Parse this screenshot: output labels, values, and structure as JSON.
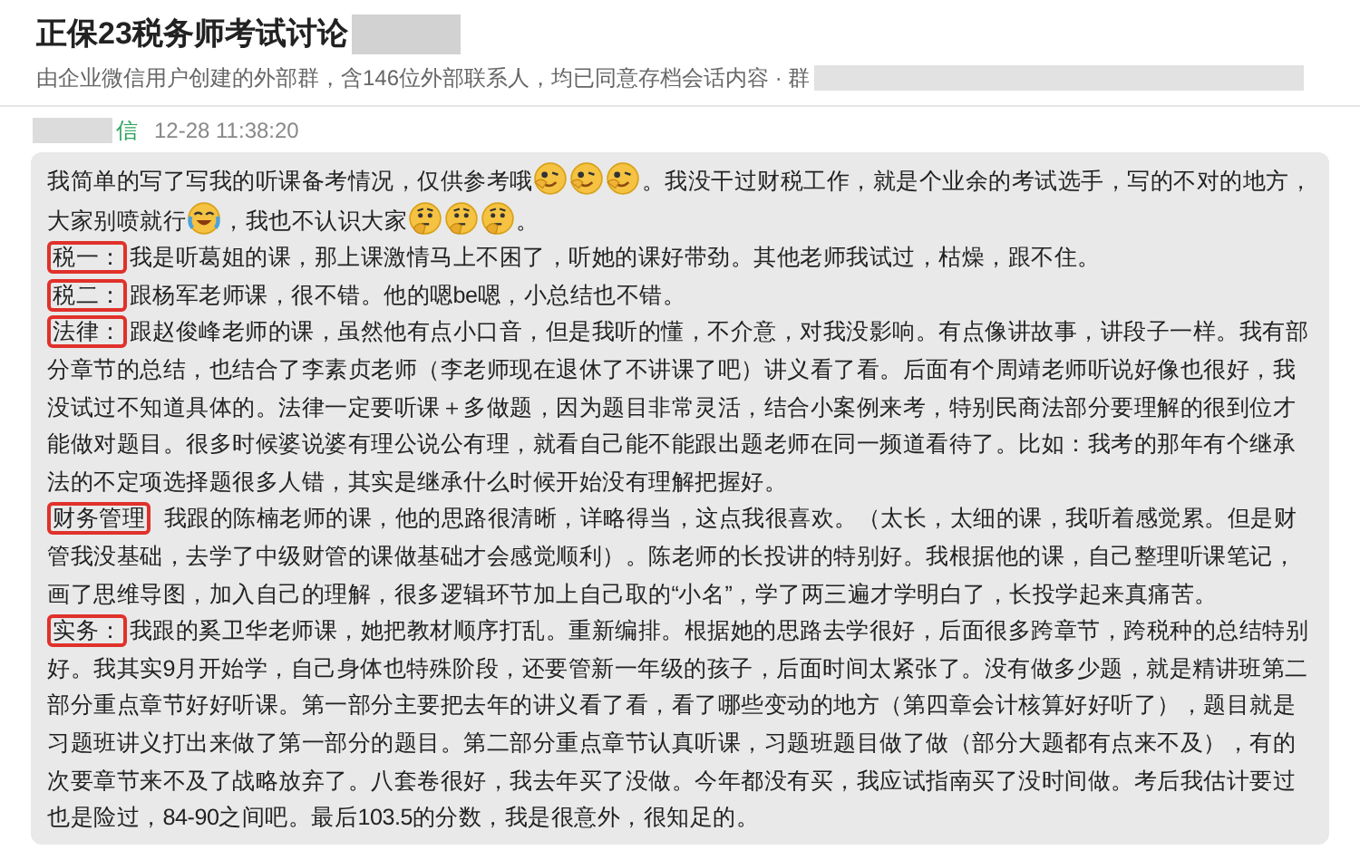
{
  "header": {
    "title": "正保23税务师考试讨论",
    "subtitle": "由企业微信用户创建的外部群，含146位外部联系人，均已同意存档会话内容 · 群"
  },
  "message": {
    "sender": "信",
    "time": "12-28 11:38:20",
    "intro": [
      {
        "kind": "text",
        "text": "我简单的写了写我的听课备考情况，仅供参考哦"
      },
      {
        "kind": "smirk"
      },
      {
        "kind": "smirk"
      },
      {
        "kind": "smirk"
      },
      {
        "kind": "text",
        "text": "。我没干过财税工作，就是个业余的考试选手，写的不对的地方，大家别喷就行"
      },
      {
        "kind": "laugh"
      },
      {
        "kind": "text",
        "text": "，我也不认识大家"
      },
      {
        "kind": "think"
      },
      {
        "kind": "think"
      },
      {
        "kind": "think"
      },
      {
        "kind": "text",
        "text": "。"
      }
    ],
    "sections": [
      {
        "label": "税一：",
        "text": "我是听葛姐的课，那上课激情马上不困了，听她的课好带劲。其他老师我试过，枯燥，跟不住。"
      },
      {
        "label": "税二：",
        "text": "跟杨军老师课，很不错。他的嗯be嗯，小总结也不错。"
      },
      {
        "label": "法律：",
        "text": "跟赵俊峰老师的课，虽然他有点小口音，但是我听的懂，不介意，对我没影响。有点像讲故事，讲段子一样。我有部分章节的总结，也结合了李素贞老师（李老师现在退休了不讲课了吧）讲义看了看。后面有个周靖老师听说好像也很好，我没试过不知道具体的。法律一定要听课＋多做题，因为题目非常灵活，结合小案例来考，特别民商法部分要理解的很到位才能做对题目。很多时候婆说婆有理公说公有理，就看自己能不能跟出题老师在同一频道看待了。比如：我考的那年有个继承法的不定项选择题很多人错，其实是继承什么时候开始没有理解把握好。"
      },
      {
        "label": "财务管理",
        "text": "  我跟的陈楠老师的课，他的思路很清晰，详略得当，这点我很喜欢。（太长，太细的课，我听着感觉累。但是财管我没基础，去学了中级财管的课做基础才会感觉顺利）。陈老师的长投讲的特别好。我根据他的课，自己整理听课笔记，画了思维导图，加入自己的理解，很多逻辑环节加上自己取的“小名”，学了两三遍才学明白了，长投学起来真痛苦。"
      },
      {
        "label": "实务：",
        "text": "我跟的奚卫华老师课，她把教材顺序打乱。重新编排。根据她的思路去学很好，后面很多跨章节，跨税种的总结特别好。我其实9月开始学，自己身体也特殊阶段，还要管新一年级的孩子，后面时间太紧张了。没有做多少题，就是精讲班第二部分重点章节好好听课。第一部分主要把去年的讲义看了看，看了哪些变动的地方（第四章会计核算好好听了），题目就是习题班讲义打出来做了第一部分的题目。第二部分重点章节认真听课，习题班题目做了做（部分大题都有点来不及），有的次要章节来不及了战略放弃了。八套卷很好，我去年买了没做。今年都没有买，我应试指南买了没时间做。考后我估计要过也是险过，84-90之间吧。最后103.5的分数，我是很意外，很知足的。"
      }
    ]
  }
}
